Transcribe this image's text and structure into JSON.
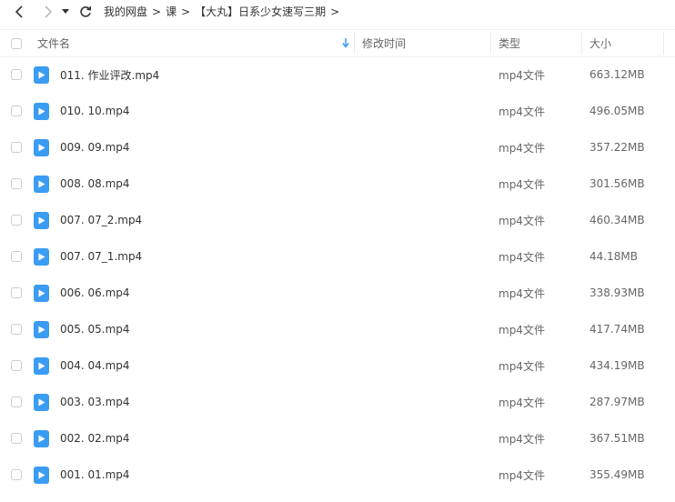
{
  "breadcrumb": {
    "items": [
      "我的网盘",
      "课",
      "【大丸】日系少女速写三期"
    ],
    "separator": ">"
  },
  "columns": {
    "name": "文件名",
    "modified": "修改时间",
    "type": "类型",
    "size": "大小"
  },
  "files": [
    {
      "name": "011. 作业评改.mp4",
      "type": "mp4文件",
      "size": "663.12MB"
    },
    {
      "name": "010. 10.mp4",
      "type": "mp4文件",
      "size": "496.05MB"
    },
    {
      "name": "009. 09.mp4",
      "type": "mp4文件",
      "size": "357.22MB"
    },
    {
      "name": "008. 08.mp4",
      "type": "mp4文件",
      "size": "301.56MB"
    },
    {
      "name": "007. 07_2.mp4",
      "type": "mp4文件",
      "size": "460.34MB"
    },
    {
      "name": "007. 07_1.mp4",
      "type": "mp4文件",
      "size": "44.18MB"
    },
    {
      "name": "006. 06.mp4",
      "type": "mp4文件",
      "size": "338.93MB"
    },
    {
      "name": "005. 05.mp4",
      "type": "mp4文件",
      "size": "417.74MB"
    },
    {
      "name": "004. 04.mp4",
      "type": "mp4文件",
      "size": "434.19MB"
    },
    {
      "name": "003. 03.mp4",
      "type": "mp4文件",
      "size": "287.97MB"
    },
    {
      "name": "002. 02.mp4",
      "type": "mp4文件",
      "size": "367.51MB"
    },
    {
      "name": "001. 01.mp4",
      "type": "mp4文件",
      "size": "355.49MB"
    }
  ],
  "colors": {
    "icon": "#3b9cf3",
    "sort_arrow": "#3b9cf3"
  }
}
